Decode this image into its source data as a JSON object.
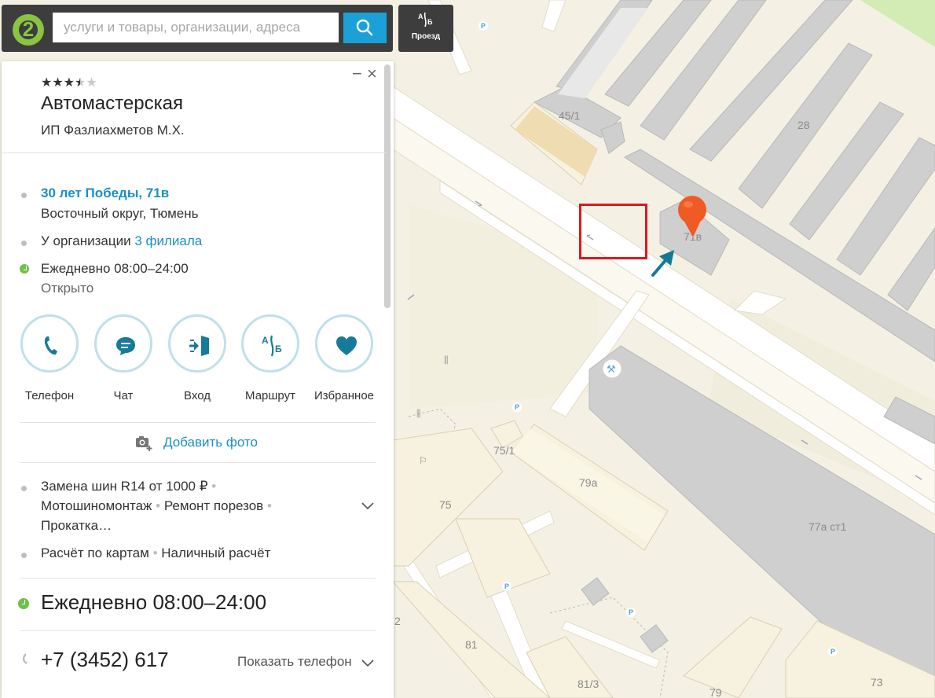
{
  "search": {
    "placeholder": "услуги и товары, организации, адреса"
  },
  "logo_text": "2",
  "route_button": {
    "label": "Проезд",
    "icon": "route-icon"
  },
  "card": {
    "rating": {
      "stars_filled": 3.5,
      "stars_total": 5
    },
    "title": "Автомастерская",
    "subtitle": "ИП Фазлиахметов М.Х.",
    "address": {
      "street": "30 лет Победы, 71в",
      "district": "Восточный округ, Тюмень"
    },
    "branches": {
      "prefix": "У организации",
      "link": "3 филиала"
    },
    "hours": {
      "schedule": "Ежедневно 08:00–24:00",
      "status": "Открыто"
    },
    "actions": [
      {
        "label": "Телефон",
        "icon": "phone-icon"
      },
      {
        "label": "Чат",
        "icon": "chat-icon"
      },
      {
        "label": "Вход",
        "icon": "entrance-icon"
      },
      {
        "label": "Маршрут",
        "icon": "route-icon"
      },
      {
        "label": "Избранное",
        "icon": "heart-icon"
      }
    ],
    "add_photo": "Добавить фото",
    "services": {
      "line1": "Замена шин R14 от 1000 ₽",
      "line2a": "Мотошиномонтаж",
      "line2b": "Ремонт порезов",
      "line3": "Прокатка…"
    },
    "payment": {
      "a": "Расчёт по картам",
      "b": "Наличный расчёт"
    },
    "hours_big": "Ежедневно 08:00–24:00",
    "phone": {
      "number": "+7 (3452) 617",
      "show_label": "Показать телефон"
    }
  },
  "map": {
    "labels": {
      "b45_1": "45/1",
      "b28": "28",
      "b71v": "71в",
      "b75_1": "75/1",
      "b79a": "79а",
      "b75": "75",
      "b77a": "77а ст1",
      "b81": "81",
      "b81_3": "81/3",
      "b79": "79",
      "b73": "73",
      "b2": "2"
    },
    "parking_label": "P",
    "colors": {
      "highlight_box": "#e0161e",
      "pin": "#f05a24",
      "arrow": "#127a96",
      "buildings": "#c9c9c9"
    }
  }
}
